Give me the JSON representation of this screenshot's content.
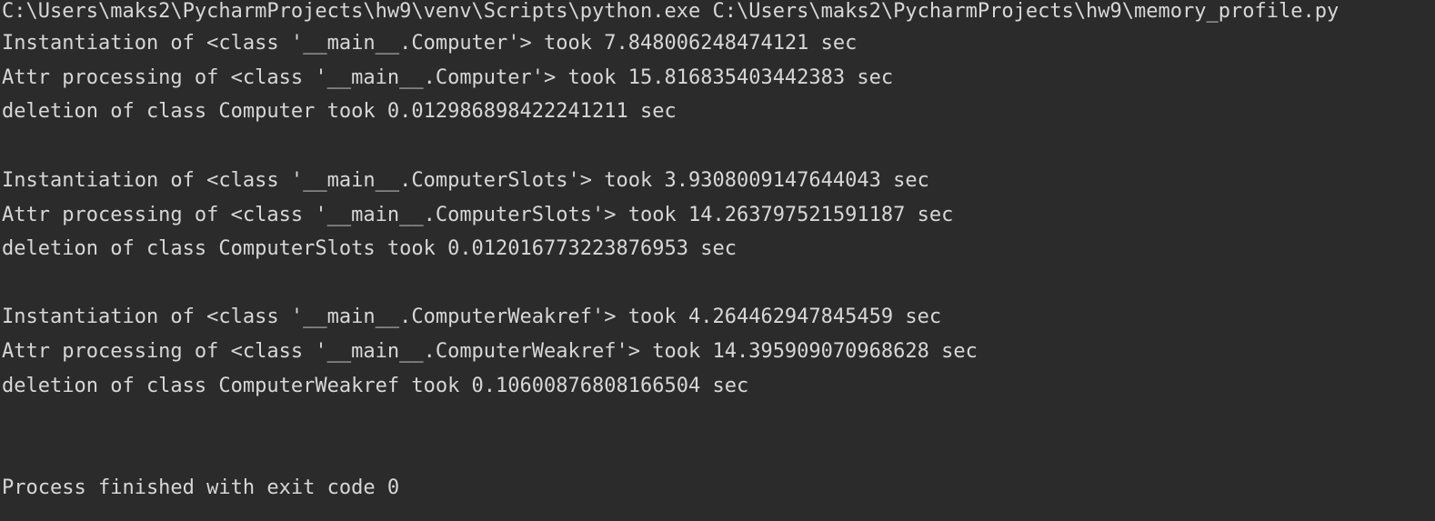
{
  "console": {
    "command_line": "C:\\Users\\maks2\\PycharmProjects\\hw9\\venv\\Scripts\\python.exe C:\\Users\\maks2\\PycharmProjects\\hw9\\memory_profile.py",
    "blocks": [
      {
        "instantiation": "Instantiation of <class '__main__.Computer'> took 7.848006248474121 sec",
        "attr_processing": "Attr processing of <class '__main__.Computer'> took 15.816835403442383 sec",
        "deletion": "deletion of class Computer took 0.012986898422241211 sec"
      },
      {
        "instantiation": "Instantiation of <class '__main__.ComputerSlots'> took 3.9308009147644043 sec",
        "attr_processing": "Attr processing of <class '__main__.ComputerSlots'> took 14.263797521591187 sec",
        "deletion": "deletion of class ComputerSlots took 0.012016773223876953 sec"
      },
      {
        "instantiation": "Instantiation of <class '__main__.ComputerWeakref'> took 4.264462947845459 sec",
        "attr_processing": "Attr processing of <class '__main__.ComputerWeakref'> took 14.395909070968628 sec",
        "deletion": "deletion of class ComputerWeakref took 0.10600876808166504 sec"
      }
    ],
    "exit_message": "Process finished with exit code 0"
  }
}
